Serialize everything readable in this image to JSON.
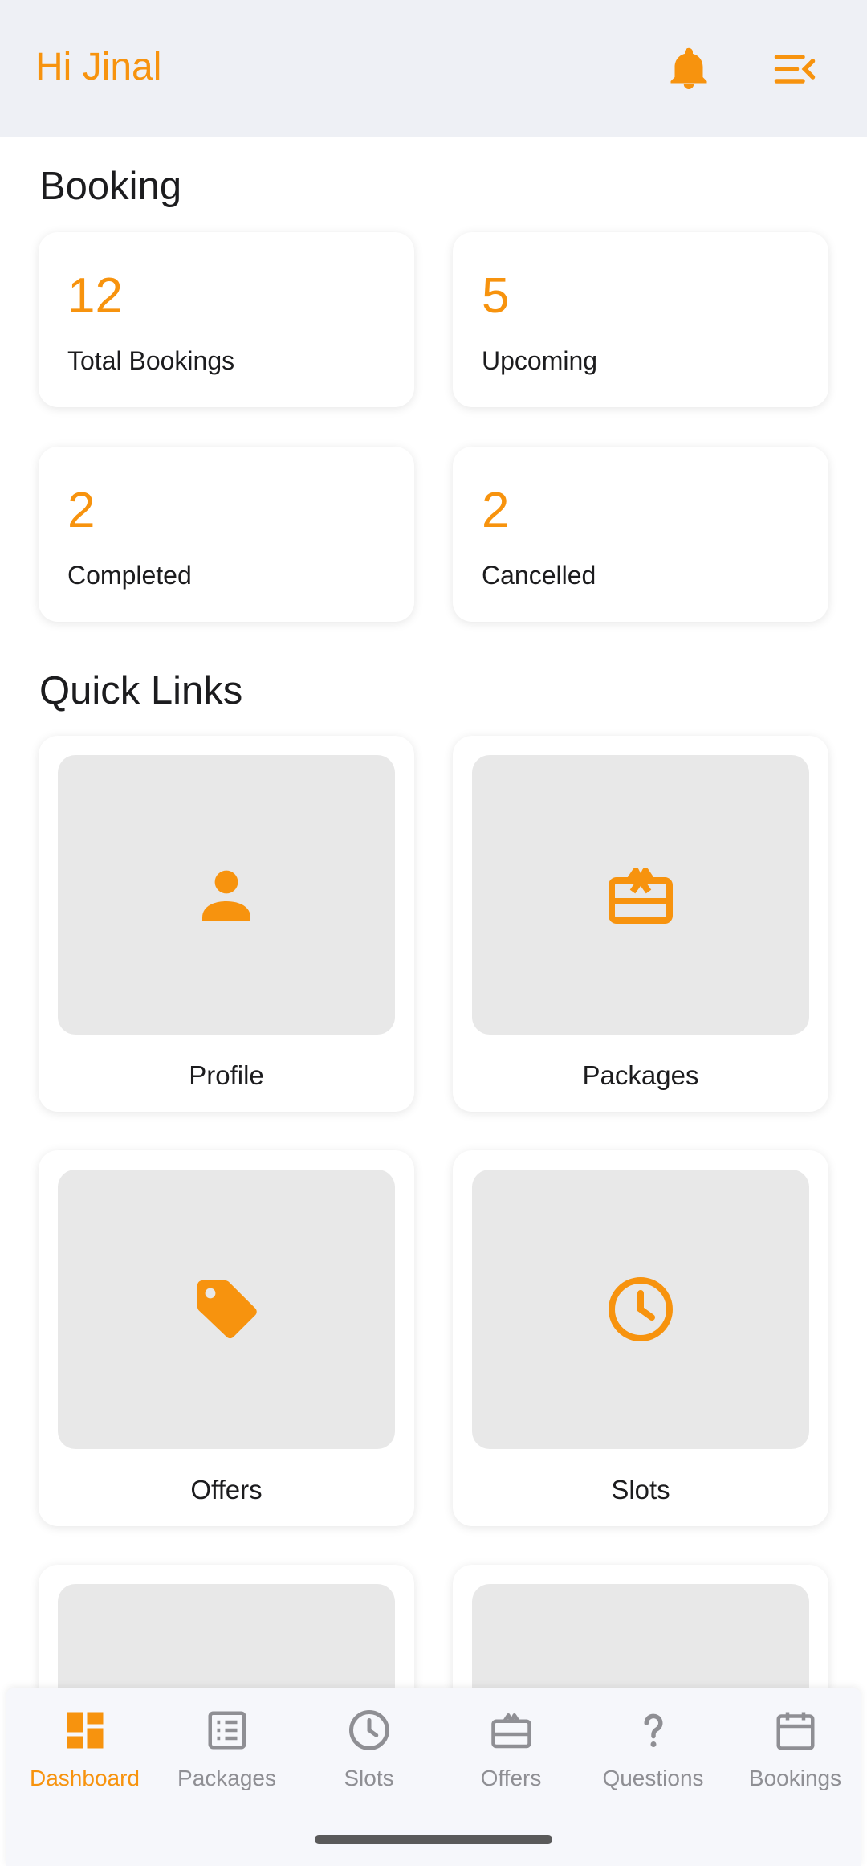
{
  "header": {
    "greeting": "Hi Jinal",
    "icons": [
      "bell-icon",
      "menu-collapse-icon"
    ]
  },
  "booking": {
    "title": "Booking",
    "stats": [
      {
        "value": "12",
        "label": "Total Bookings"
      },
      {
        "value": "5",
        "label": "Upcoming"
      },
      {
        "value": "2",
        "label": "Completed"
      },
      {
        "value": "2",
        "label": "Cancelled"
      }
    ]
  },
  "quick_links": {
    "title": "Quick Links",
    "items": [
      {
        "label": "Profile",
        "icon": "person-icon"
      },
      {
        "label": "Packages",
        "icon": "gift-card-icon"
      },
      {
        "label": "Offers",
        "icon": "tag-icon"
      },
      {
        "label": "Slots",
        "icon": "clock-icon"
      },
      {
        "label": "",
        "icon": "blank"
      },
      {
        "label": "",
        "icon": "partially-hidden-icon"
      }
    ]
  },
  "bottom_nav": {
    "active": "Dashboard",
    "items": [
      {
        "label": "Dashboard",
        "icon": "dashboard-icon"
      },
      {
        "label": "Packages",
        "icon": "list-icon"
      },
      {
        "label": "Slots",
        "icon": "clock-icon"
      },
      {
        "label": "Offers",
        "icon": "gift-card-icon"
      },
      {
        "label": "Questions",
        "icon": "question-icon"
      },
      {
        "label": "Bookings",
        "icon": "calendar-icon"
      }
    ]
  },
  "colors": {
    "accent": "#f7930e",
    "header_bg": "#eef0f5",
    "tile_bg": "#e8e8e8",
    "nav_inactive": "#8f8f94"
  }
}
